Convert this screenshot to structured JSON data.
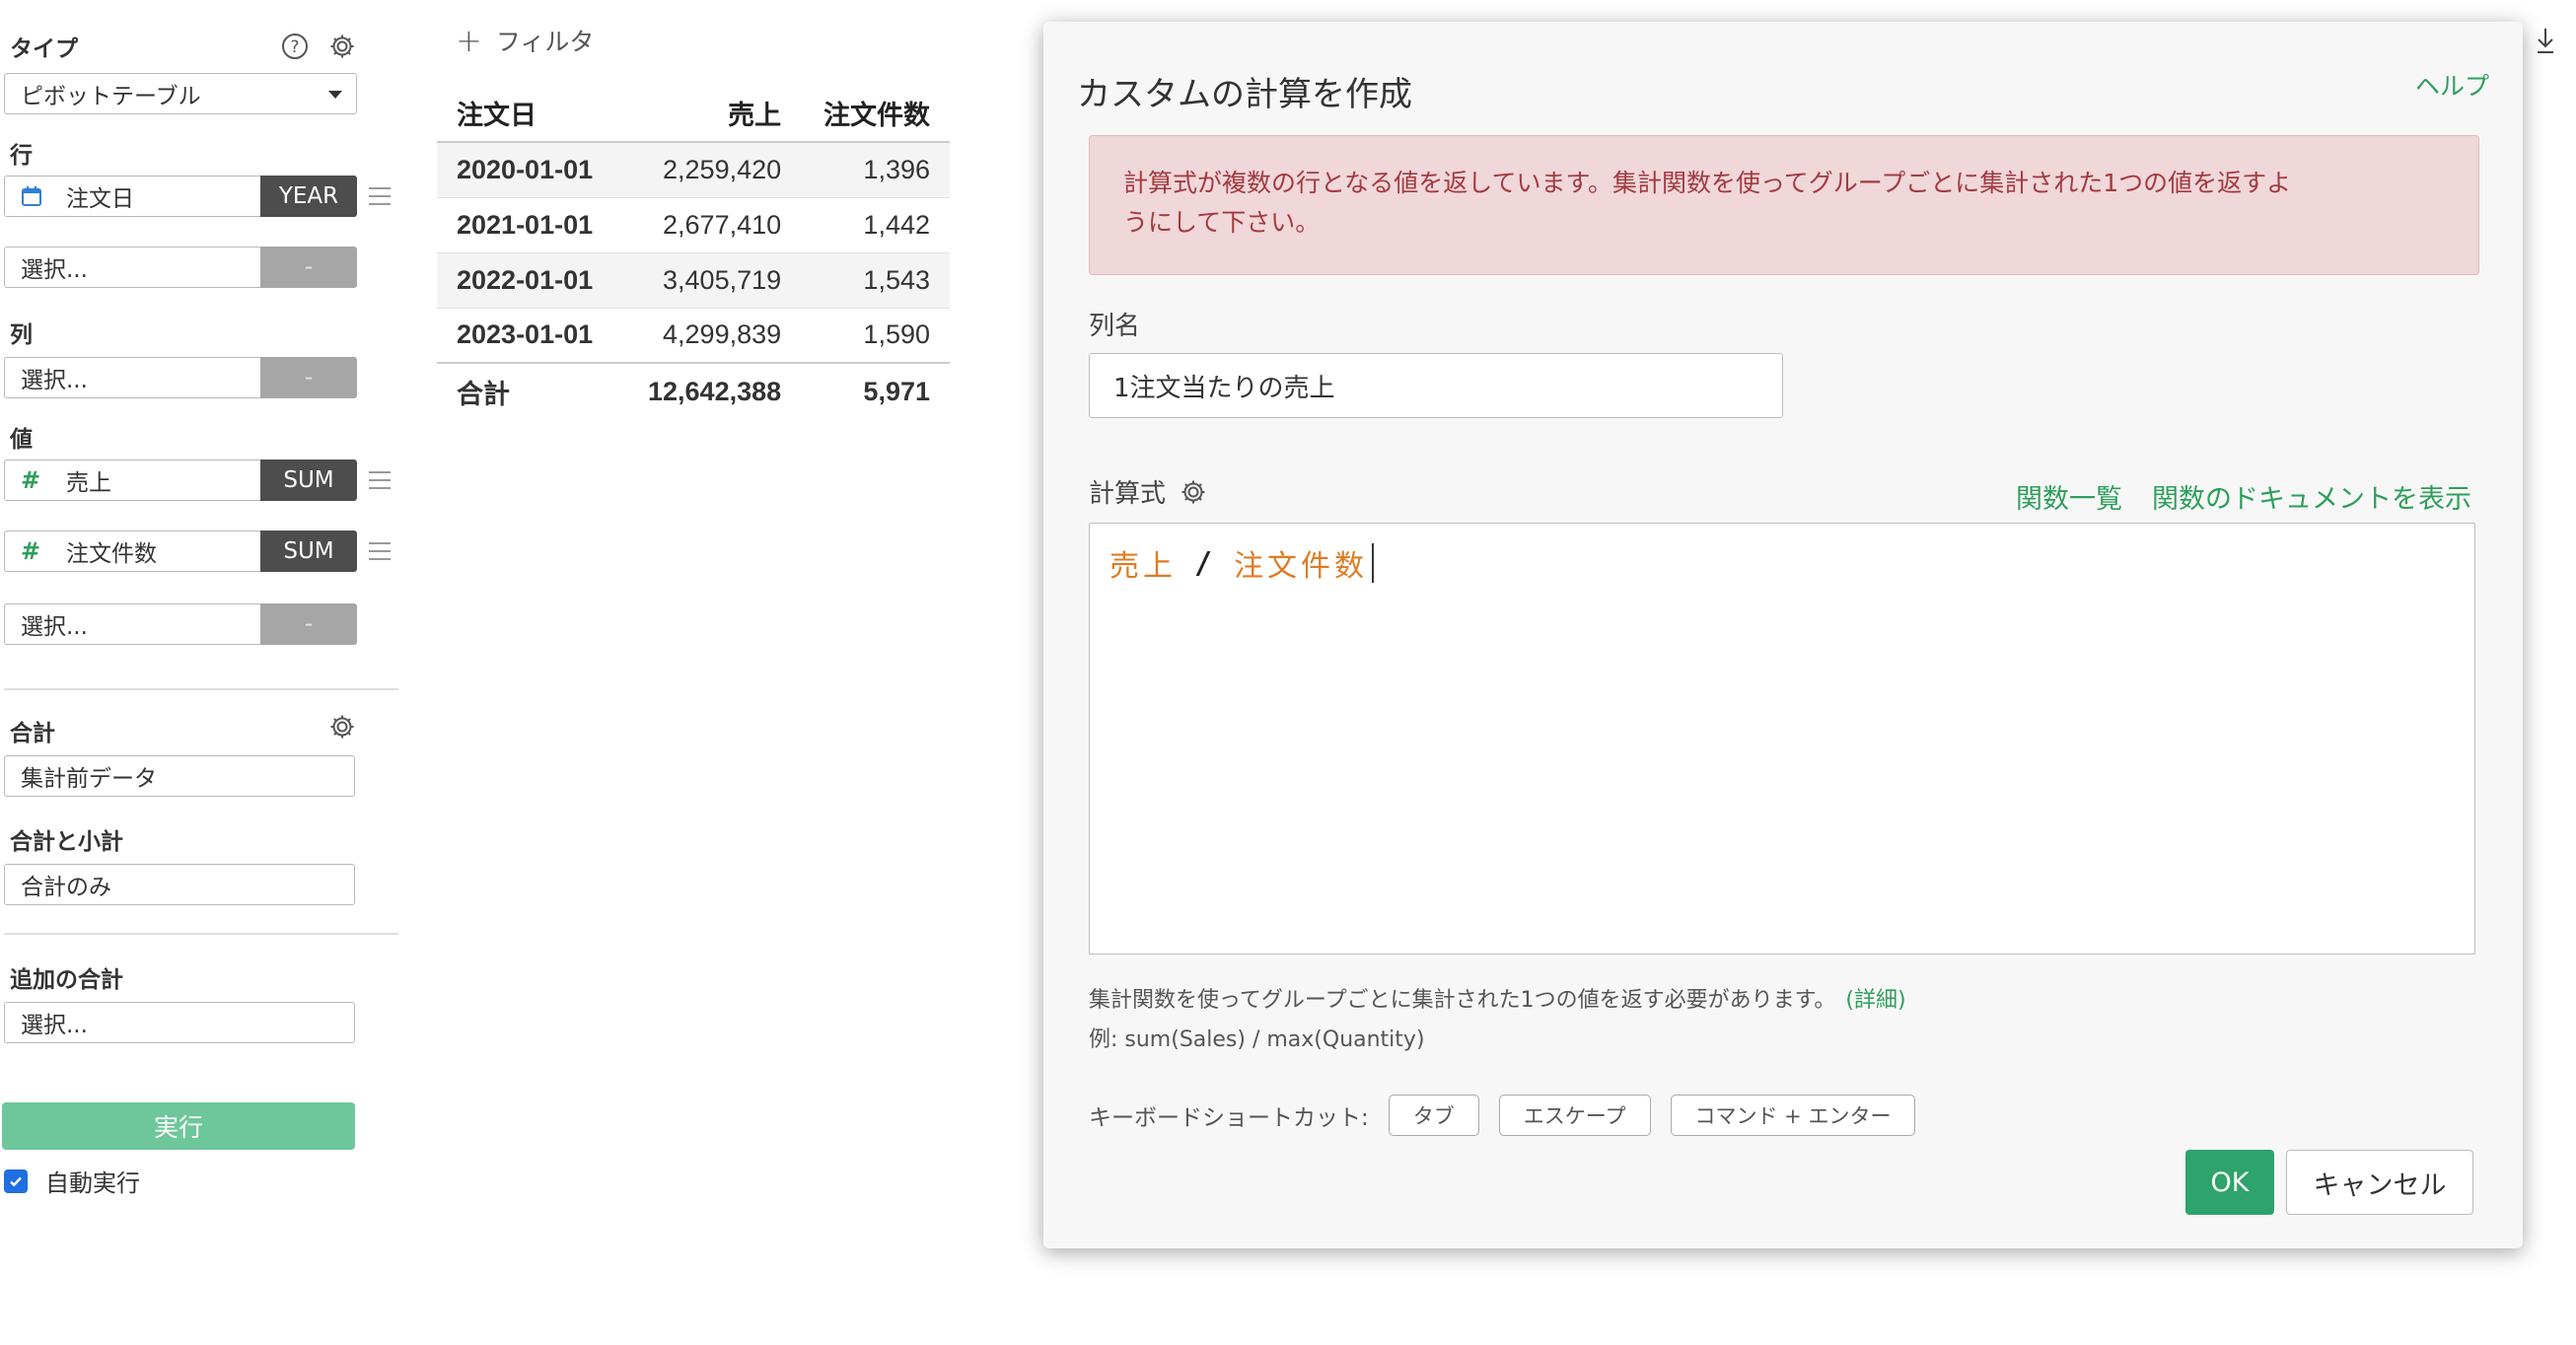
{
  "sidebar": {
    "type_label": "タイプ",
    "type_value": "ピボットテーブル",
    "rows_label": "行",
    "row_field": {
      "name": "注文日",
      "agg": "YEAR"
    },
    "select_placeholder": "選択...",
    "empty_btn": "-",
    "columns_label": "列",
    "values_label": "値",
    "value_fields": [
      {
        "name": "売上",
        "agg": "SUM"
      },
      {
        "name": "注文件数",
        "agg": "SUM"
      }
    ],
    "total_label": "合計",
    "total_value": "集計前データ",
    "subtotal_label": "合計と小計",
    "subtotal_value": "合計のみ",
    "extra_total_label": "追加の合計",
    "run_button": "実行",
    "auto_run_label": "自動実行",
    "auto_run_checked": true
  },
  "filter": {
    "label": "フィルタ"
  },
  "pivot": {
    "headers": [
      "注文日",
      "売上",
      "注文件数"
    ],
    "rows": [
      [
        "2020-01-01",
        "2,259,420",
        "1,396"
      ],
      [
        "2021-01-01",
        "2,677,410",
        "1,442"
      ],
      [
        "2022-01-01",
        "3,405,719",
        "1,543"
      ],
      [
        "2023-01-01",
        "4,299,839",
        "1,590"
      ]
    ],
    "total": [
      "合計",
      "12,642,388",
      "5,971"
    ]
  },
  "modal": {
    "title": "カスタムの計算を作成",
    "help": "ヘルプ",
    "error_line1": "計算式が複数の行となる値を返しています。集計関数を使ってグループごとに集計された1つの値を返すよ",
    "error_line2": "うにして下さい。",
    "name_label": "列名",
    "name_value": "1注文当たりの売上",
    "formula_label": "計算式",
    "func_list": "関数一覧",
    "func_docs": "関数のドキュメントを表示",
    "formula": {
      "left": "売上",
      "op": "/",
      "right": "注文件数"
    },
    "hint_text": "集計関数を使ってグループごとに集計された1つの値を返す必要があります。",
    "hint_more": "(詳細)",
    "example": "例: sum(Sales) / max(Quantity)",
    "shortcuts_label": "キーボードショートカット:",
    "shortcuts": [
      "タブ",
      "エスケープ",
      "コマンド + エンター"
    ],
    "ok": "OK",
    "cancel": "キャンセル"
  },
  "colors": {
    "accent_green": "#2e9e5b",
    "error_text": "#a33a3f",
    "error_bg": "#f0d7d9",
    "field_orange": "#e07b22"
  }
}
